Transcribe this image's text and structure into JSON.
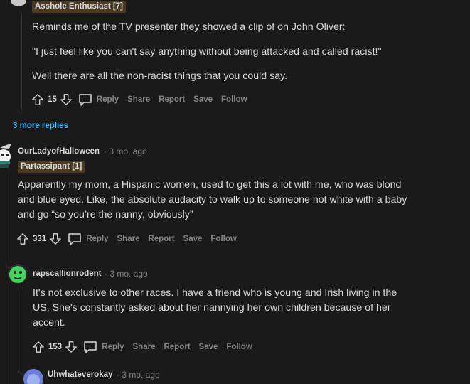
{
  "comment_top": {
    "flair": "Asshole Enthusiast [7]",
    "p1": "Reminds me of the TV presenter they showed a clip of on John Oliver:",
    "p2": "\"I just feel like you can't say anything without being attacked and called racist!\"",
    "p3": "Well there are all the non-racist things that you could say.",
    "votes": "15"
  },
  "more_replies": "3 more replies",
  "comment_ourlady": {
    "username": "OurLadyofHalloween",
    "time": "· 3 mo. ago",
    "flair": "Partassipant [1]",
    "l1": "Apparently my mom, a Hispanic women, used to get this a lot with me, who was blond",
    "l2": "and blue eyed. Like, the absolute audacity to walk up to someone not white with a baby",
    "l3": "and go “so you’re the nanny, obviously”",
    "votes": "331"
  },
  "comment_rap": {
    "username": "rapscallionrodent",
    "time": "· 3 mo. ago",
    "l1": "It's not exclusive to other races. I have a friend who is young and Irish living in the",
    "l2": "US. She's constantly asked about her nannying her own children because of her",
    "l3": "accent.",
    "votes": "153"
  },
  "comment_uh": {
    "username": "Uhwhateverokay",
    "time": "· 3 mo. ago"
  },
  "actions": {
    "reply": "Reply",
    "share": "Share",
    "report": "Report",
    "save": "Save",
    "follow": "Follow"
  },
  "colors": {
    "background": "#1a1a1b",
    "text": "#d7dadc",
    "muted": "#818384",
    "link": "#4fbcff",
    "flair_bg": "#4a3a22"
  }
}
